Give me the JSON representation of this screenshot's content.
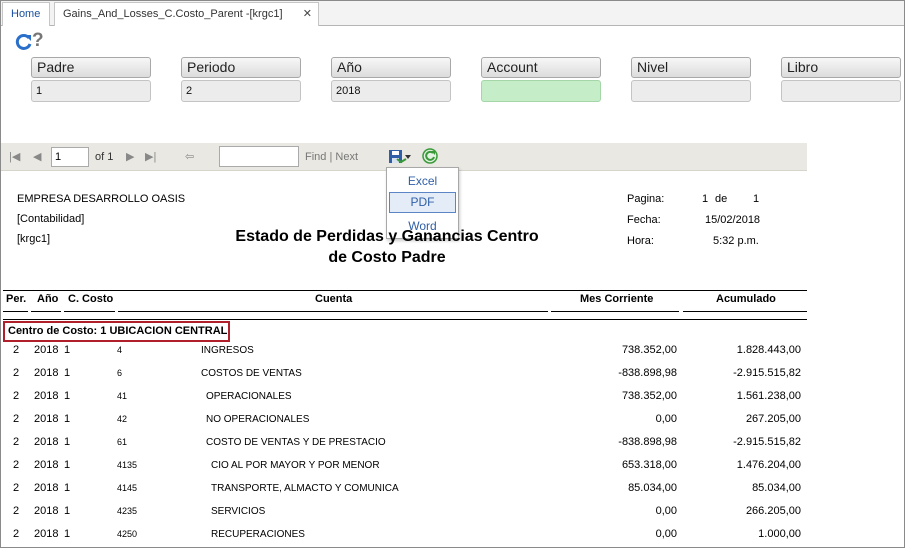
{
  "tabs": {
    "home": "Home",
    "active": "Gains_And_Losses_C.Costo_Parent -[krgc1]",
    "close": "✕"
  },
  "params": [
    {
      "label": "Padre",
      "value": "1",
      "green": false
    },
    {
      "label": "Periodo",
      "value": "2",
      "green": false
    },
    {
      "label": "Año",
      "value": "2018",
      "green": false
    },
    {
      "label": "Account",
      "value": "",
      "green": true
    },
    {
      "label": "Nivel",
      "value": "",
      "green": false
    },
    {
      "label": "Libro",
      "value": "",
      "green": false
    }
  ],
  "toolbar": {
    "page": "1",
    "of_text": "of 1",
    "find": "Find",
    "sep": "|",
    "next": "Next"
  },
  "export_menu": [
    "Excel",
    "PDF",
    "Word"
  ],
  "report": {
    "company": "EMPRESA DESARROLLO OASIS",
    "dept": "[Contabilidad]",
    "user": "[krgc1]",
    "title_line1": "Estado de Perdidas y Ganancias Centro",
    "title_line2": "de Costo Padre",
    "pagina_label": "Pagina:",
    "pagina_num": "1",
    "de_label": "de",
    "pagina_total": "1",
    "fecha_label": "Fecha:",
    "fecha": "15/02/2018",
    "hora_label": "Hora:",
    "hora": "5:32 p.m."
  },
  "columns": {
    "per": "Per.",
    "ano": "Año",
    "ccosto": "C. Costo",
    "cuenta": "Cuenta",
    "mes": "Mes Corriente",
    "acum": "Acumulado"
  },
  "centro_costo": "Centro de Costo: 1  UBICACION CENTRAL",
  "rows": [
    {
      "per": "2",
      "ano": "2018",
      "cc": "1",
      "code": "4",
      "cuenta": "INGRESOS",
      "indent": 0,
      "mes": "738.352,00",
      "acum": "1.828.443,00"
    },
    {
      "per": "2",
      "ano": "2018",
      "cc": "1",
      "code": "6",
      "cuenta": "COSTOS DE VENTAS",
      "indent": 0,
      "mes": "-838.898,98",
      "acum": "-2.915.515,82"
    },
    {
      "per": "2",
      "ano": "2018",
      "cc": "1",
      "code": "41",
      "cuenta": "OPERACIONALES",
      "indent": 1,
      "mes": "738.352,00",
      "acum": "1.561.238,00"
    },
    {
      "per": "2",
      "ano": "2018",
      "cc": "1",
      "code": "42",
      "cuenta": "NO OPERACIONALES",
      "indent": 1,
      "mes": "0,00",
      "acum": "267.205,00"
    },
    {
      "per": "2",
      "ano": "2018",
      "cc": "1",
      "code": "61",
      "cuenta": "COSTO DE VENTAS Y DE PRESTACIO",
      "indent": 1,
      "mes": "-838.898,98",
      "acum": "-2.915.515,82"
    },
    {
      "per": "2",
      "ano": "2018",
      "cc": "1",
      "code": "4135",
      "cuenta": "CIO AL POR MAYOR Y POR MENOR",
      "indent": 2,
      "mes": "653.318,00",
      "acum": "1.476.204,00"
    },
    {
      "per": "2",
      "ano": "2018",
      "cc": "1",
      "code": "4145",
      "cuenta": "TRANSPORTE, ALMACTO Y COMUNICA",
      "indent": 2,
      "mes": "85.034,00",
      "acum": "85.034,00"
    },
    {
      "per": "2",
      "ano": "2018",
      "cc": "1",
      "code": "4235",
      "cuenta": "SERVICIOS",
      "indent": 2,
      "mes": "0,00",
      "acum": "266.205,00"
    },
    {
      "per": "2",
      "ano": "2018",
      "cc": "1",
      "code": "4250",
      "cuenta": "RECUPERACIONES",
      "indent": 2,
      "mes": "0,00",
      "acum": "1.000,00"
    }
  ]
}
